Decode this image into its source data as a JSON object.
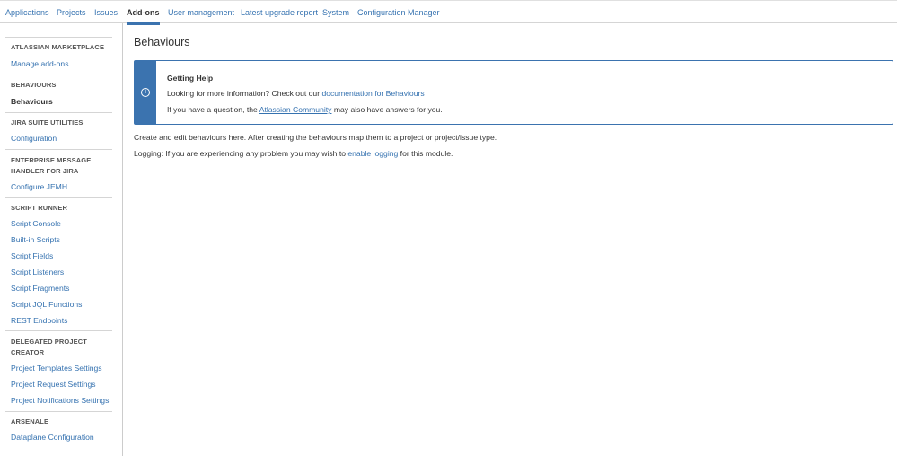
{
  "topnav": {
    "tabs": [
      {
        "label": "Applications"
      },
      {
        "label": "Projects"
      },
      {
        "label": "Issues"
      },
      {
        "label": "Add-ons"
      },
      {
        "label": "User management"
      },
      {
        "label": "Latest upgrade report"
      },
      {
        "label": "System"
      },
      {
        "label": "Configuration Manager"
      }
    ],
    "active": "Add-ons"
  },
  "sidebar": {
    "sections": [
      {
        "heading": "ATLASSIAN MARKETPLACE",
        "items": [
          "Manage add-ons"
        ]
      },
      {
        "heading": "BEHAVIOURS",
        "items": [
          "Behaviours"
        ]
      },
      {
        "heading": "JIRA SUITE UTILITIES",
        "items": [
          "Configuration"
        ]
      },
      {
        "heading_line1": "ENTERPRISE MESSAGE",
        "heading_line2": "HANDLER FOR JIRA",
        "items": [
          "Configure JEMH"
        ]
      },
      {
        "heading": "SCRIPT RUNNER",
        "items": [
          "Script Console",
          "Built-in Scripts",
          "Script Fields",
          "Script Listeners",
          "Script Fragments",
          "Script JQL Functions",
          "REST Endpoints"
        ]
      },
      {
        "heading_line1": "DELEGATED PROJECT",
        "heading_line2": "CREATOR",
        "items": [
          "Project Templates Settings",
          "Project Request Settings",
          "Project Notifications Settings"
        ]
      },
      {
        "heading": "ARSENALE",
        "items": [
          "Dataplane Configuration"
        ]
      }
    ],
    "current": "Behaviours"
  },
  "main": {
    "title": "Behaviours",
    "help": {
      "icon": "info-icon",
      "heading": "Getting Help",
      "line1_prefix": "Looking for more information? Check out our ",
      "line1_link": "documentation for Behaviours",
      "line2_prefix": "If you have a question, the ",
      "line2_link": "Atlassian Community",
      "line2_suffix": " may also have answers for you."
    },
    "description": "Create and edit behaviours here. After creating the behaviours map them to a project or project/issue type.",
    "logging_prefix": "Logging: If you are experiencing any problem you may wish to ",
    "logging_link": "enable logging",
    "logging_suffix": " for this module."
  },
  "colors": {
    "link": "#3572b0",
    "accent": "#3b73af",
    "text": "#333333",
    "border": "#d5d5d5"
  }
}
